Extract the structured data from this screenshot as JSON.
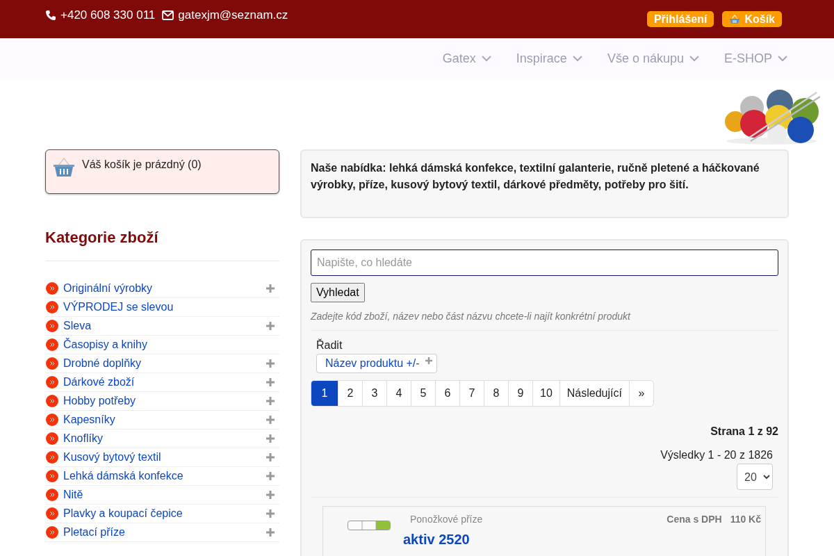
{
  "top_bar": {
    "phone": "+420 608 330 011",
    "email": "gatexjm@seznam.cz",
    "login_button": "Přihlášení",
    "cart_button": "Košík"
  },
  "nav": [
    {
      "label": "Gatex"
    },
    {
      "label": "Inspirace"
    },
    {
      "label": "Vše o nákupu"
    },
    {
      "label": "E-SHOP"
    }
  ],
  "cart_box": {
    "text": "Váš košík je prázdný (0)"
  },
  "categories": {
    "title": "Kategorie zboží",
    "items": [
      {
        "label": "Originální výrobky",
        "has_children": true
      },
      {
        "label": "VÝPRODEJ se slevou",
        "has_children": false
      },
      {
        "label": "Sleva",
        "has_children": true
      },
      {
        "label": "Časopisy a knihy",
        "has_children": false
      },
      {
        "label": "Drobné doplňky",
        "has_children": true
      },
      {
        "label": "Dárkové zboží",
        "has_children": true
      },
      {
        "label": "Hobby potřeby",
        "has_children": true
      },
      {
        "label": "Kapesníky",
        "has_children": true
      },
      {
        "label": "Knoflíky",
        "has_children": true
      },
      {
        "label": "Kusový bytový textil",
        "has_children": true
      },
      {
        "label": "Lehká dámská konfekce",
        "has_children": true
      },
      {
        "label": "Nitě",
        "has_children": true
      },
      {
        "label": "Plavky a koupací čepice",
        "has_children": true
      },
      {
        "label": "Pletací příze",
        "has_children": true
      }
    ]
  },
  "intro": "Naše nabídka: lehká dámská konfekce, textilní galanterie, ručně pletené a háčkované výrobky, příze, kusový bytový textil, dárkové předměty, potřeby pro šití.",
  "search": {
    "placeholder": "Napište, co hledáte",
    "button": "Vyhledat",
    "hint": "Zadejte kód zboží, název nebo část názvu chcete-li najít konkrétní produkt"
  },
  "sort": {
    "label": "Řadit",
    "value": "Název produktu +/-"
  },
  "pagination": [
    {
      "label": "1",
      "selected": true
    },
    {
      "label": "2",
      "selected": false
    },
    {
      "label": "3",
      "selected": false
    },
    {
      "label": "4",
      "selected": false
    },
    {
      "label": "5",
      "selected": false
    },
    {
      "label": "6",
      "selected": false
    },
    {
      "label": "7",
      "selected": false
    },
    {
      "label": "8",
      "selected": false
    },
    {
      "label": "9",
      "selected": false
    },
    {
      "label": "10",
      "selected": false
    },
    {
      "label": "Následující",
      "selected": false
    },
    {
      "label": "»",
      "selected": false
    }
  ],
  "page_info": "Strana 1 z 92",
  "results": "Výsledky 1 - 20 z 1826",
  "per_page": "20",
  "product": {
    "category": "Ponožkové příze",
    "price_label": "Cena s DPH",
    "price": "110 Kč",
    "name": "aktiv 2520"
  }
}
